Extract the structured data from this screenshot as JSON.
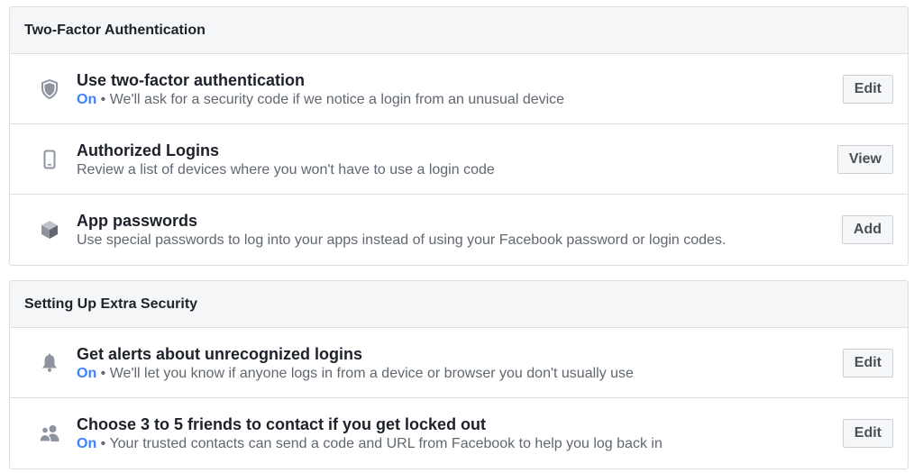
{
  "two_factor": {
    "header": "Two-Factor Authentication",
    "rows": [
      {
        "icon": "shield-icon",
        "title": "Use two-factor authentication",
        "status": "On",
        "separator": "•",
        "desc": "We'll ask for a security code if we notice a login from an unusual device",
        "button": "Edit"
      },
      {
        "icon": "phone-icon",
        "title": "Authorized Logins",
        "desc": "Review a list of devices where you won't have to use a login code",
        "button": "View"
      },
      {
        "icon": "cube-icon",
        "title": "App passwords",
        "desc": "Use special passwords to log into your apps instead of using your Facebook password or login codes.",
        "button": "Add"
      }
    ]
  },
  "extra_security": {
    "header": "Setting Up Extra Security",
    "rows": [
      {
        "icon": "bell-icon",
        "title": "Get alerts about unrecognized logins",
        "status": "On",
        "separator": "•",
        "desc": "We'll let you know if anyone logs in from a device or browser you don't usually use",
        "button": "Edit"
      },
      {
        "icon": "friends-icon",
        "title": "Choose 3 to 5 friends to contact if you get locked out",
        "status": "On",
        "separator": "•",
        "desc": "Your trusted contacts can send a code and URL from Facebook to help you log back in",
        "button": "Edit"
      }
    ]
  },
  "colors": {
    "status_on": "#4080ff",
    "icon_gray": "#8d949e",
    "panel_header_bg": "#f5f6f7",
    "border": "#dddfe2"
  }
}
